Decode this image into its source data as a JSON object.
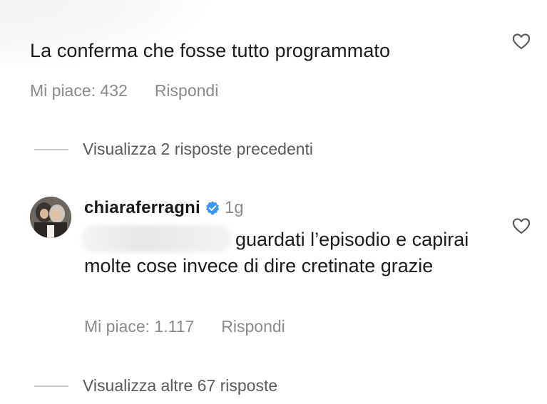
{
  "comment": {
    "text": "La conferma che fosse tutto programmato",
    "likes": "Mi piace: 432",
    "reply_label": "Rispondi",
    "view_previous": "Visualizza 2 risposte precedenti"
  },
  "reply": {
    "username": "chiaraferragni",
    "time": "1g",
    "text": "guardati l’episodio e capirai molte cose invece di dire cretinate grazie",
    "likes": "Mi piace: 1.117",
    "reply_label": "Rispondi",
    "view_more": "Visualizza altre 67 risposte"
  },
  "icons": {
    "like": "heart-outline-icon",
    "verified": "verified-badge-icon"
  },
  "colors": {
    "text": "#1c1c1c",
    "meta": "#8a8a8a",
    "verified_blue": "#3897f0"
  }
}
